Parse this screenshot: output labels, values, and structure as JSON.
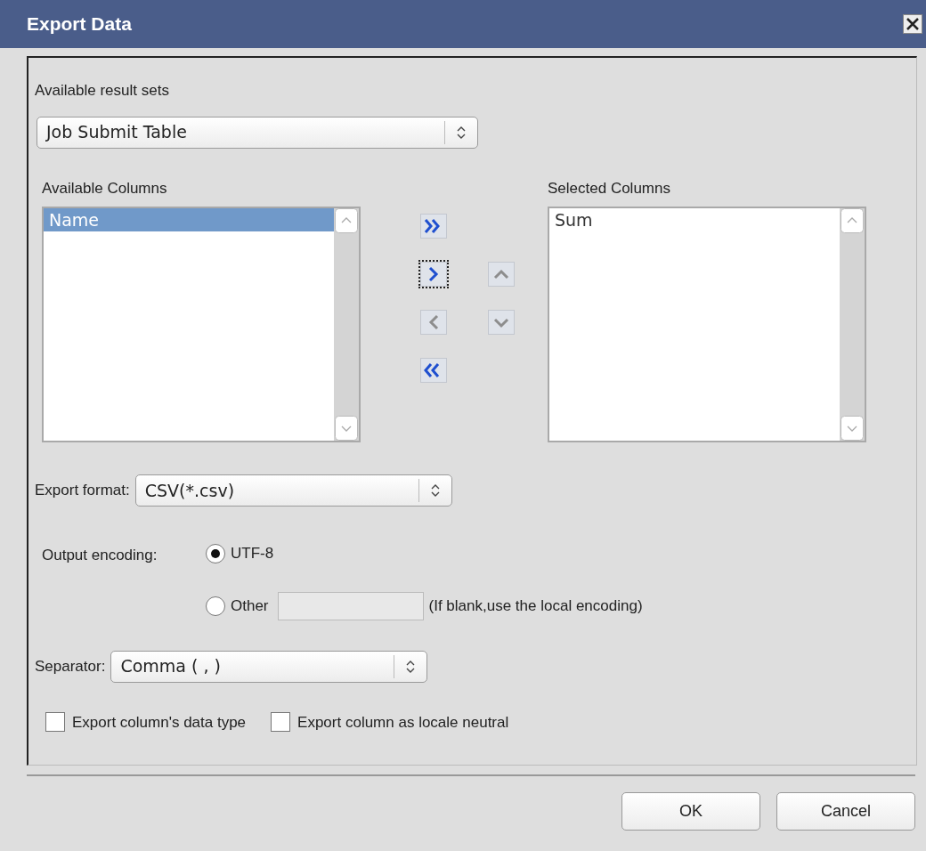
{
  "window": {
    "title": "Export Data"
  },
  "result_sets": {
    "label": "Available result sets",
    "value": "Job Submit Table"
  },
  "available_columns": {
    "label": "Available Columns",
    "items": [
      {
        "label": "Name",
        "selected": true
      }
    ]
  },
  "arrow_buttons": [
    {
      "kind": "add-all",
      "enabled": true,
      "focused": false
    },
    {
      "kind": "add",
      "enabled": true,
      "focused": true
    },
    {
      "kind": "up",
      "enabled": false,
      "focused": false
    },
    {
      "kind": "remove",
      "enabled": false,
      "focused": false
    },
    {
      "kind": "down",
      "enabled": false,
      "focused": false
    },
    {
      "kind": "remove-all",
      "enabled": true,
      "focused": false
    }
  ],
  "selected_columns": {
    "label": "Selected Columns",
    "items": [
      {
        "label": "Sum",
        "selected": false
      }
    ]
  },
  "export_format": {
    "label": "Export format:",
    "value": "CSV(*.csv)"
  },
  "output_encoding": {
    "label": "Output encoding:",
    "options": [
      {
        "label": "UTF-8",
        "selected": true
      },
      {
        "label": "Other",
        "selected": false
      }
    ],
    "hint": "(If blank,use the local encoding)"
  },
  "separator": {
    "label": "Separator:",
    "value": "Comma ( , )"
  },
  "checkboxes": [
    {
      "label": "Export column's data type",
      "checked": false
    },
    {
      "label": "Export column as locale neutral",
      "checked": false
    }
  ],
  "buttons": [
    "OK",
    "Cancel"
  ]
}
